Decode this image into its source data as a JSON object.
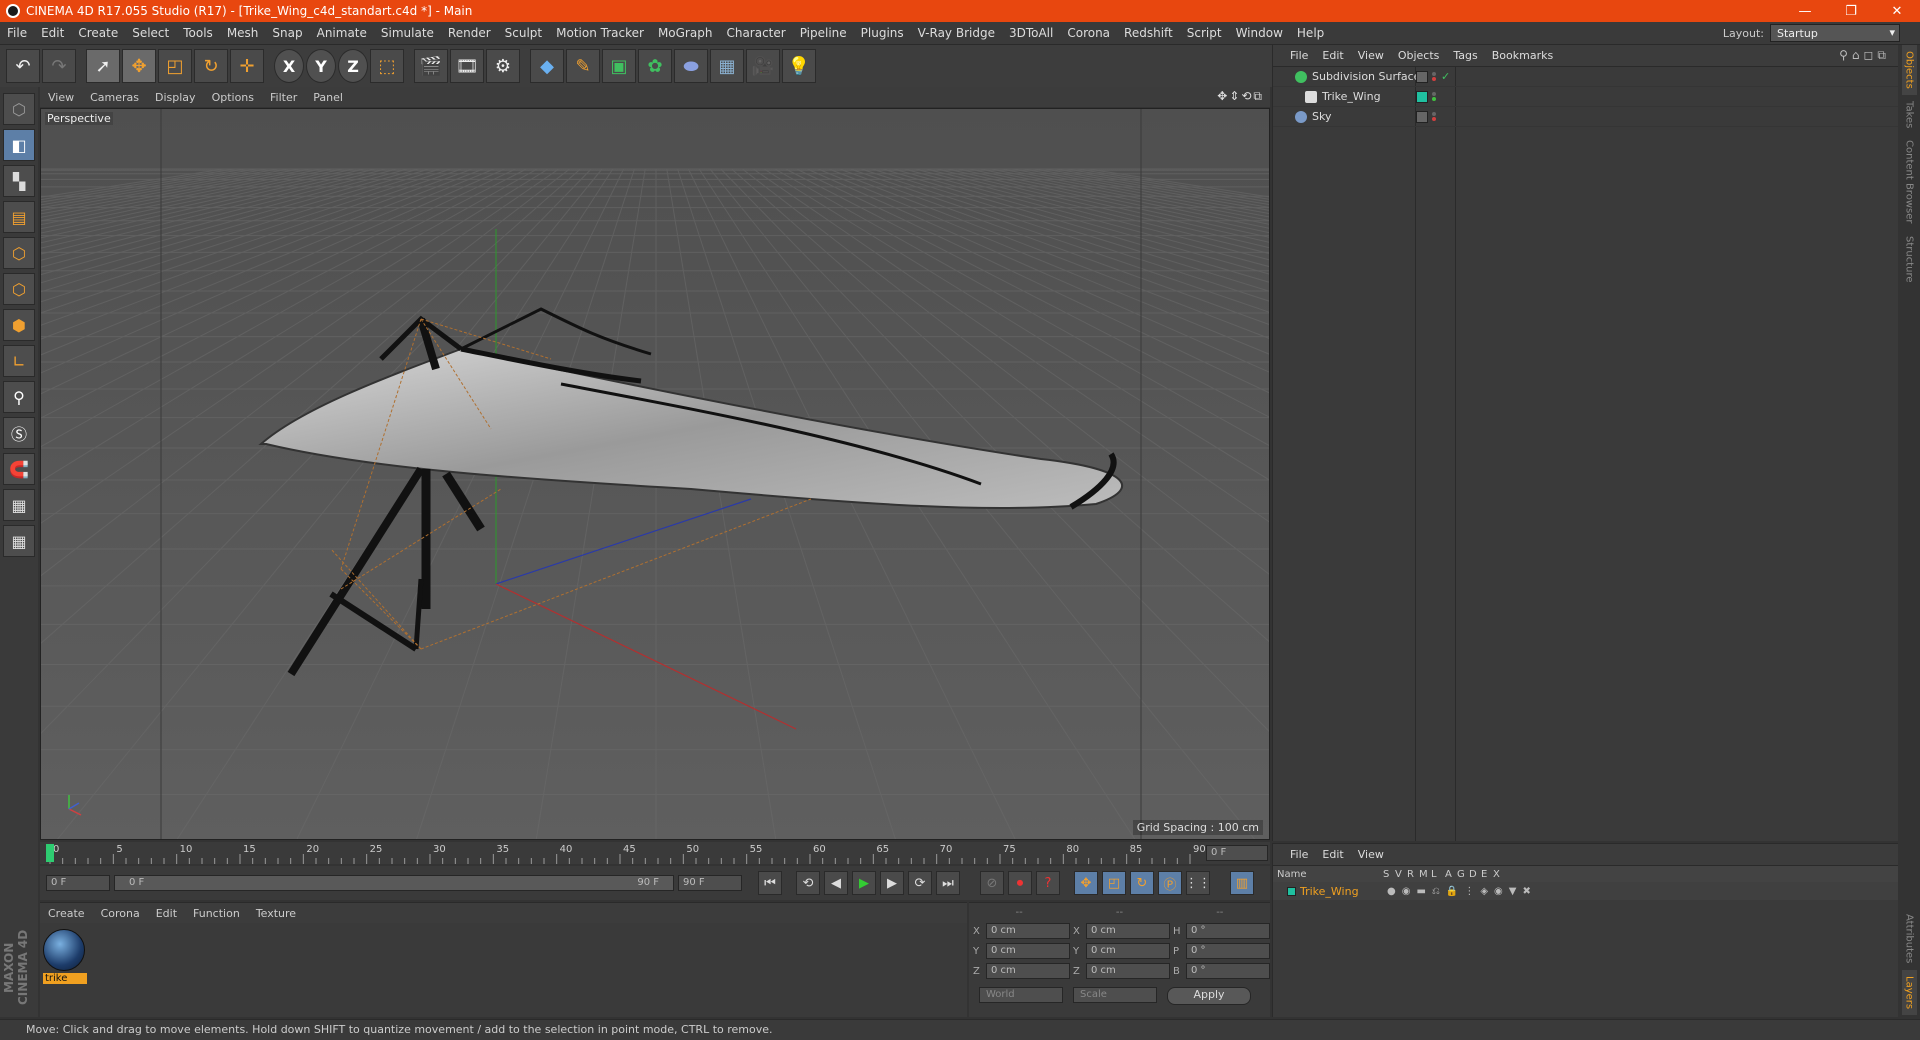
{
  "window": {
    "title": "CINEMA 4D R17.055 Studio (R17) - [Trike_Wing_c4d_standart.c4d *] - Main",
    "minimize": "—",
    "restore": "❐",
    "close": "✕"
  },
  "menubar": {
    "items": [
      "File",
      "Edit",
      "Create",
      "Select",
      "Tools",
      "Mesh",
      "Snap",
      "Animate",
      "Simulate",
      "Render",
      "Sculpt",
      "Motion Tracker",
      "MoGraph",
      "Character",
      "Pipeline",
      "Plugins",
      "V-Ray Bridge",
      "3DToAll",
      "Corona",
      "Redshift",
      "Script",
      "Window",
      "Help"
    ],
    "layout_label": "Layout:",
    "layout_value": "Startup"
  },
  "viewport": {
    "menu": [
      "View",
      "Cameras",
      "Display",
      "Options",
      "Filter",
      "Panel"
    ],
    "label": "Perspective",
    "grid_spacing": "Grid Spacing : 100 cm"
  },
  "timeline": {
    "ticks": [
      "0",
      "5",
      "10",
      "15",
      "20",
      "25",
      "30",
      "35",
      "40",
      "45",
      "50",
      "55",
      "60",
      "65",
      "70",
      "75",
      "80",
      "85",
      "90"
    ],
    "current_frame": "0 F",
    "start_field": "0 F",
    "slider_start": "0 F",
    "slider_end": "90 F",
    "end_field": "90 F"
  },
  "material_panel": {
    "menu": [
      "Create",
      "Corona",
      "Edit",
      "Function",
      "Texture"
    ],
    "material_name": "trike"
  },
  "coord_panel": {
    "headers": [
      "--",
      "--",
      "--"
    ],
    "rows": [
      {
        "l1": "X",
        "v1": "0 cm",
        "l2": "X",
        "v2": "0 cm",
        "l3": "H",
        "v3": "0 °"
      },
      {
        "l1": "Y",
        "v1": "0 cm",
        "l2": "Y",
        "v2": "0 cm",
        "l3": "P",
        "v3": "0 °"
      },
      {
        "l1": "Z",
        "v1": "0 cm",
        "l2": "Z",
        "v2": "0 cm",
        "l3": "B",
        "v3": "0 °"
      }
    ],
    "space": "World",
    "mode": "Scale",
    "apply": "Apply"
  },
  "objects_panel": {
    "menu": [
      "File",
      "Edit",
      "View",
      "Objects",
      "Tags",
      "Bookmarks"
    ],
    "items": [
      {
        "name": "Subdivision Surface",
        "color": "#40c060"
      },
      {
        "name": "Trike_Wing",
        "color": "#dddddd"
      },
      {
        "name": "Sky",
        "color": "#7a9ac8"
      }
    ]
  },
  "layers_panel": {
    "menu": [
      "File",
      "Edit",
      "View"
    ],
    "columns": [
      "Name",
      "S",
      "V",
      "R",
      "M",
      "L",
      "A",
      "G",
      "D",
      "E",
      "X"
    ],
    "layer_name": "Trike_Wing"
  },
  "side_tabs": [
    "Objects",
    "Takes",
    "Content Browser",
    "Structure",
    "Attributes",
    "Layers"
  ],
  "status": "Move: Click and drag to move elements. Hold down SHIFT to quantize movement / add to the selection in point mode, CTRL to remove.",
  "branding": "MAXON CINEMA 4D",
  "colors": {
    "title_bar": "#e8470f",
    "accent": "#f0a020",
    "selection_blue": "#5d7fa7"
  }
}
